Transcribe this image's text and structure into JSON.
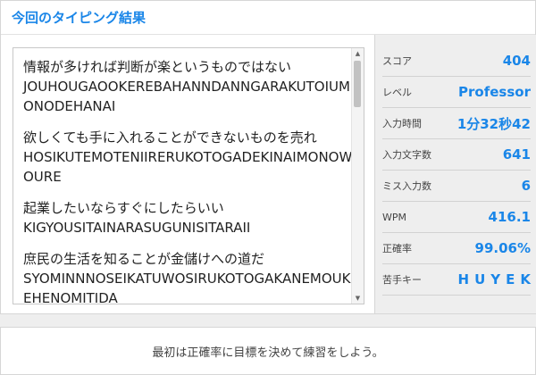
{
  "header": {
    "title": "今回のタイピング結果"
  },
  "history": [
    {
      "jp": "情報が多ければ判断が楽というものではない",
      "roma": "JOUHOUGAOOKEREBAHANNDANNGARAKUTOIUMONODEHANAI"
    },
    {
      "jp": "欲しくても手に入れることができないものを売れ",
      "roma": "HOSIKUTEMOTENIIRERUKOTOGADEKINAIMONOWOURE"
    },
    {
      "jp": "起業したいならすぐにしたらいい",
      "roma": "KIGYOUSITAINARASUGUNISITARAII"
    },
    {
      "jp": "庶民の生活を知ることが金儲けへの道だ",
      "roma": "SYOMINNNOSEIKATUWOSIRUKOTOGAKANEMOUKEHENOMITIDA"
    }
  ],
  "stats": [
    {
      "label": "スコア",
      "value": "404"
    },
    {
      "label": "レベル",
      "value": "Professor"
    },
    {
      "label": "入力時間",
      "value": "1分32秒42"
    },
    {
      "label": "入力文字数",
      "value": "641"
    },
    {
      "label": "ミス入力数",
      "value": "6"
    },
    {
      "label": "WPM",
      "value": "416.1"
    },
    {
      "label": "正確率",
      "value": "99.06%"
    },
    {
      "label": "苦手キー",
      "value": "HUYEK"
    }
  ],
  "footer": {
    "message": "最初は正確率に目標を決めて練習をしよう。"
  },
  "colors": {
    "accent": "#1a86e8"
  }
}
